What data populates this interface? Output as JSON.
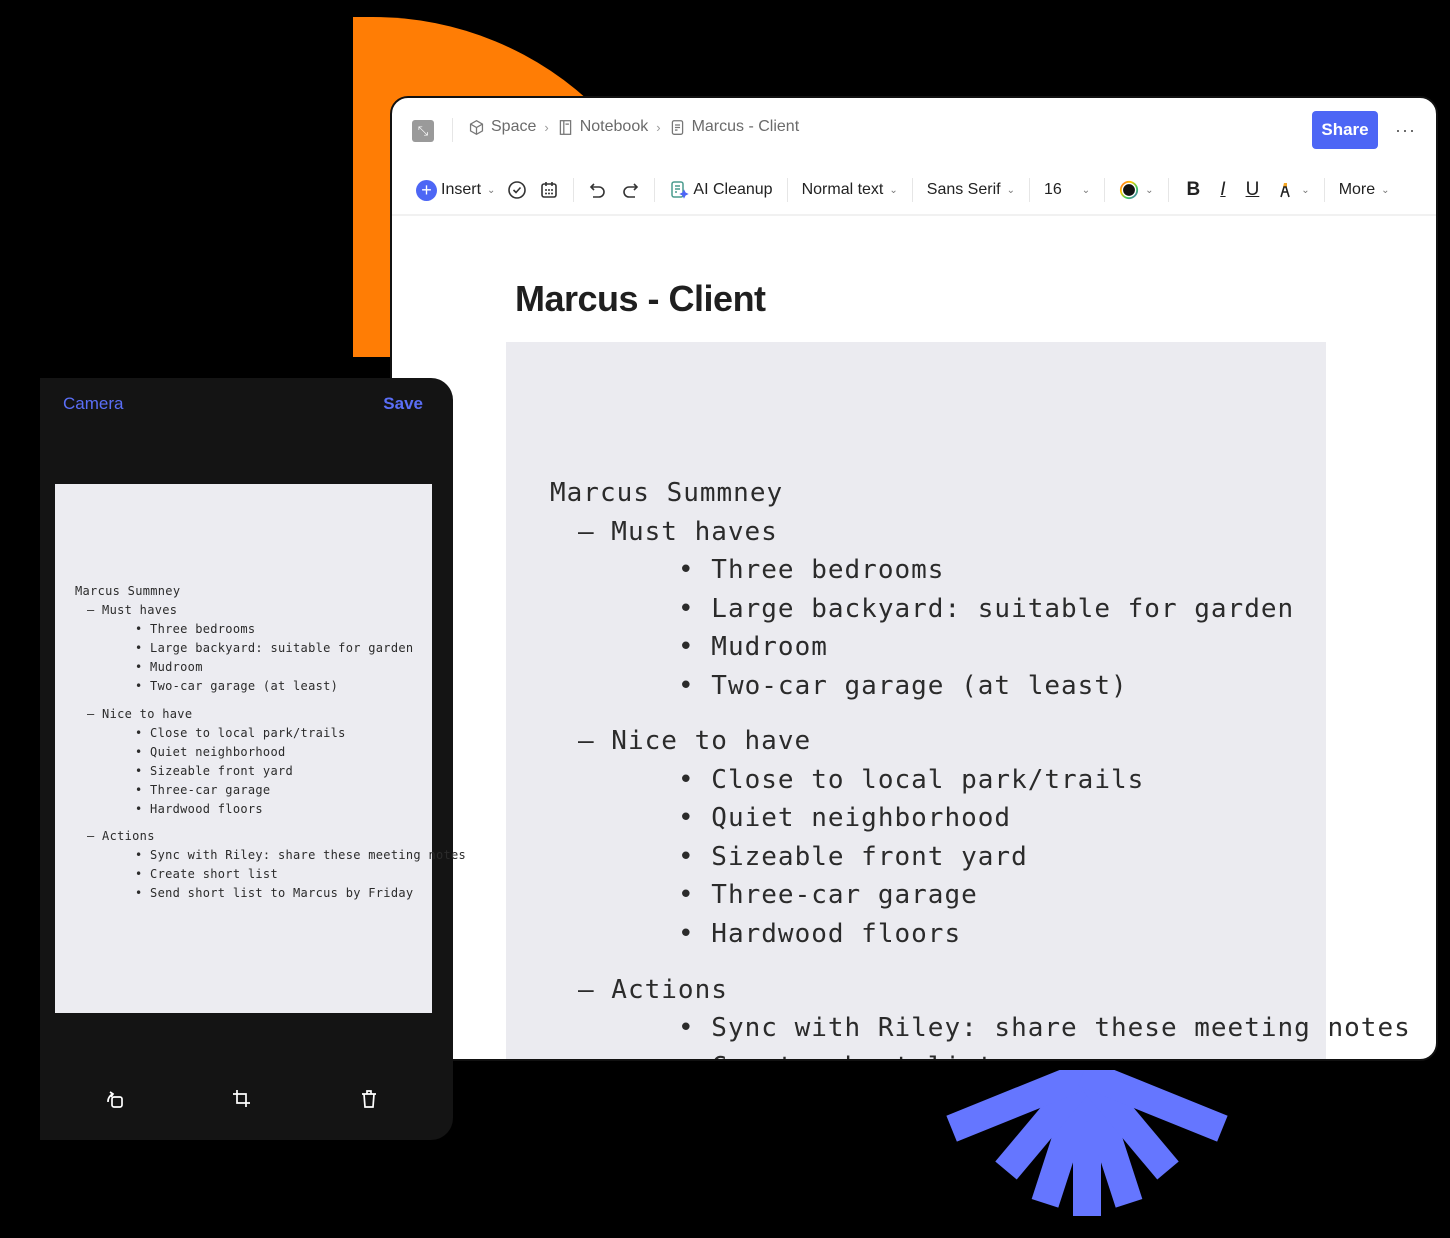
{
  "colors": {
    "accent": "#4d66f5",
    "orange": "#ff7d05",
    "rays": "#6576ff",
    "phone_bg": "#141414",
    "phone_link": "#5a6ef6"
  },
  "editor": {
    "breadcrumb": [
      {
        "icon": "cube-icon",
        "label": "Space"
      },
      {
        "icon": "notebook-icon",
        "label": "Notebook"
      },
      {
        "icon": "document-icon",
        "label": "Marcus - Client"
      }
    ],
    "share_label": "Share",
    "more_menu": "···",
    "toolbar": {
      "insert": "Insert",
      "ai_cleanup": "AI Cleanup",
      "text_style": "Normal text",
      "font": "Sans Serif",
      "font_size": "16",
      "bold": "B",
      "italic": "I",
      "underline": "U",
      "more": "More"
    },
    "doc_title": "Marcus - Client"
  },
  "notes": [
    {
      "level": 0,
      "text": "Marcus Summney"
    },
    {
      "level": 1,
      "text": "– Must haves"
    },
    {
      "level": 2,
      "text": "• Three bedrooms"
    },
    {
      "level": 2,
      "text": "• Large backyard: suitable for garden"
    },
    {
      "level": 2,
      "text": "• Mudroom"
    },
    {
      "level": 2,
      "text": "• Two-car garage (at least)"
    },
    {
      "level": 1,
      "text": "– Nice to have"
    },
    {
      "level": 2,
      "text": "• Close to local park/trails"
    },
    {
      "level": 2,
      "text": "• Quiet neighborhood"
    },
    {
      "level": 2,
      "text": "• Sizeable front yard"
    },
    {
      "level": 2,
      "text": "• Three-car garage"
    },
    {
      "level": 2,
      "text": "• Hardwood floors"
    },
    {
      "level": 1,
      "text": "– Actions"
    },
    {
      "level": 2,
      "text": "• Sync with Riley: share these meeting notes"
    },
    {
      "level": 2,
      "text": "• Create short list"
    },
    {
      "level": 2,
      "text": "• Send short list to Marcus by Friday"
    }
  ],
  "phone": {
    "camera_label": "Camera",
    "save_label": "Save",
    "bottom_icons": [
      "rotate-icon",
      "crop-icon",
      "trash-icon"
    ]
  }
}
